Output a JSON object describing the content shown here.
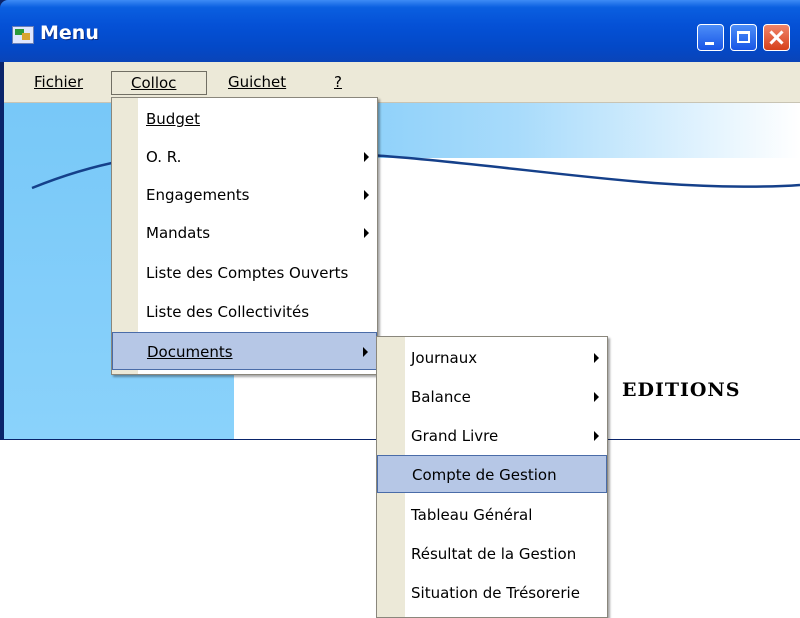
{
  "window": {
    "title": "Menu",
    "accent": "#0551d6"
  },
  "menubar": [
    {
      "label": "Fichier"
    },
    {
      "label": "Colloc"
    },
    {
      "label": "Guichet"
    },
    {
      "label": "?"
    }
  ],
  "background": {
    "heading": "EDITIONS"
  },
  "colloc_menu": [
    {
      "label": "Budget",
      "submenu": false
    },
    {
      "label": "O. R.",
      "submenu": true
    },
    {
      "label": "Engagements",
      "submenu": true
    },
    {
      "label": "Mandats",
      "submenu": true
    },
    {
      "label": "Liste des Comptes Ouverts",
      "submenu": false
    },
    {
      "label": "Liste des Collectivités",
      "submenu": false
    },
    {
      "label": "Documents",
      "submenu": true,
      "highlighted": true
    }
  ],
  "documents_menu": [
    {
      "label": "Journaux",
      "submenu": true
    },
    {
      "label": "Balance",
      "submenu": true
    },
    {
      "label": "Grand Livre",
      "submenu": true
    },
    {
      "label": "Compte de Gestion",
      "submenu": false,
      "highlighted": true
    },
    {
      "label": "Tableau Général",
      "submenu": false
    },
    {
      "label": "Résultat de la Gestion",
      "submenu": false
    },
    {
      "label": "Situation de Trésorerie",
      "submenu": false
    }
  ],
  "colors": {
    "menu_highlight": "#b6c7e6",
    "menubar_bg": "#ece9d8",
    "client_blue": "#78c8f8"
  }
}
